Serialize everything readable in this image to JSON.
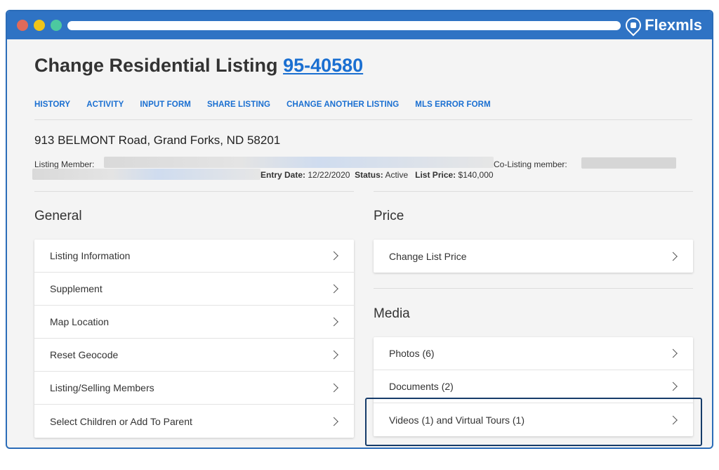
{
  "brand": {
    "name": "Flexmls",
    "logo_icon": "home-pin-icon"
  },
  "colors": {
    "titlebar": "#2f73c4",
    "link": "#1a6fd1",
    "highlight": "#163c6a"
  },
  "page": {
    "title_prefix": "Change Residential Listing",
    "listing_number": "95-40580"
  },
  "tabs": [
    {
      "label": "HISTORY"
    },
    {
      "label": "ACTIVITY"
    },
    {
      "label": "INPUT FORM"
    },
    {
      "label": "SHARE LISTING"
    },
    {
      "label": "CHANGE ANOTHER LISTING"
    },
    {
      "label": "MLS ERROR FORM"
    }
  ],
  "listing": {
    "address": "913 BELMONT Road, Grand Forks, ND 58201",
    "listing_member_label": "Listing Member:",
    "co_listing_member_label": "Co-Listing member:",
    "entry_date_label": "Entry Date:",
    "entry_date": "12/22/2020",
    "status_label": "Status:",
    "status": "Active",
    "list_price_label": "List Price:",
    "list_price": "$140,000"
  },
  "general": {
    "title": "General",
    "items": [
      {
        "label": "Listing Information"
      },
      {
        "label": "Supplement"
      },
      {
        "label": "Map Location"
      },
      {
        "label": "Reset Geocode"
      },
      {
        "label": "Listing/Selling Members"
      },
      {
        "label": "Select Children or Add To Parent"
      }
    ]
  },
  "price": {
    "title": "Price",
    "items": [
      {
        "label": "Change List Price"
      }
    ]
  },
  "media": {
    "title": "Media",
    "items": [
      {
        "label": "Photos (6)"
      },
      {
        "label": "Documents (2)"
      },
      {
        "label": "Videos (1) and Virtual Tours (1)"
      }
    ]
  }
}
